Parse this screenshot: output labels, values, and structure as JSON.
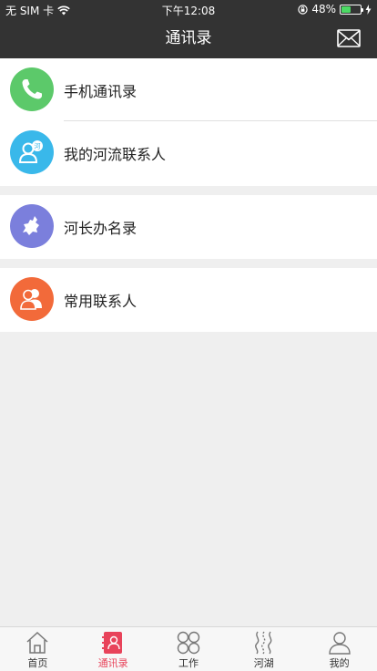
{
  "status_bar": {
    "carrier": "无 SIM 卡",
    "time": "下午12:08",
    "battery": "48%",
    "battery_level": 0.48
  },
  "nav": {
    "title": "通讯录"
  },
  "contacts": {
    "items": [
      {
        "label": "手机通讯录",
        "icon": "phone-icon",
        "color": "#5cc96a"
      },
      {
        "label": "我的河流联系人",
        "icon": "river-contacts-icon",
        "color": "#39b8ea"
      },
      {
        "label": "河长办名录",
        "icon": "river-office-icon",
        "color": "#7b7fdc"
      },
      {
        "label": "常用联系人",
        "icon": "frequent-contacts-icon",
        "color": "#f26a3a"
      }
    ]
  },
  "tabbar": {
    "items": [
      {
        "label": "首页",
        "icon": "home-icon"
      },
      {
        "label": "通讯录",
        "icon": "contacts-icon",
        "active": true
      },
      {
        "label": "工作",
        "icon": "work-icon"
      },
      {
        "label": "河湖",
        "icon": "river-lake-icon"
      },
      {
        "label": "我的",
        "icon": "profile-icon"
      }
    ]
  },
  "colors": {
    "nav_bg": "#333333",
    "accent": "#e8435a",
    "page_bg": "#efefef"
  }
}
